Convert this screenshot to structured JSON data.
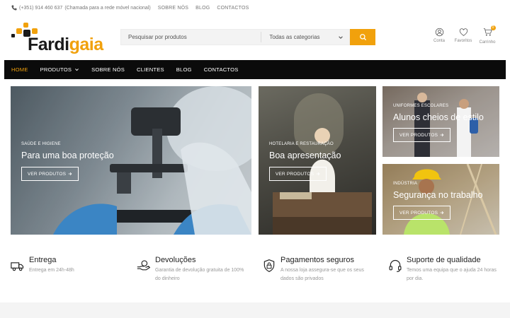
{
  "topbar": {
    "phone": "(+351) 914 460 637",
    "phone_note": "(Chamada para a rede móvel nacional)",
    "links": [
      "SOBRE NÓS",
      "BLOG",
      "CONTACTOS"
    ]
  },
  "logo": {
    "part1": "Fardi",
    "part2": "gaia"
  },
  "search": {
    "placeholder": "Pesquisar por produtos",
    "category": "Todas as categorias"
  },
  "header_icons": [
    {
      "name": "user-icon",
      "label": "Conta"
    },
    {
      "name": "heart-icon",
      "label": "Favoritos"
    },
    {
      "name": "cart-icon",
      "label": "Carrinho",
      "badge": "0"
    }
  ],
  "nav": {
    "items": [
      {
        "label": "HOME",
        "active": true
      },
      {
        "label": "PRODUTOS",
        "dropdown": true
      },
      {
        "label": "SOBRE NÓS"
      },
      {
        "label": "CLIENTES"
      },
      {
        "label": "BLOG"
      },
      {
        "label": "CONTACTOS"
      }
    ]
  },
  "banners": [
    {
      "label": "SAÚDE E HIGIENE",
      "headline": "Para uma boa proteção",
      "cta": "VER PRODUTOS"
    },
    {
      "label": "HOTELARIA E RESTAURAÇÃO",
      "headline": "Boa apresentação",
      "cta": "VER PRODUTOS"
    },
    {
      "label": "UNIFORMES ESCOLARES",
      "headline": "Alunos cheios de estilo",
      "cta": "VER PRODUTOS"
    },
    {
      "label": "INDÚSTRIA",
      "headline": "Segurança no trabalho",
      "cta": "VER PRODUTOS"
    }
  ],
  "features": [
    {
      "icon": "truck-icon",
      "title": "Entrega",
      "desc": "Entrega em 24h-48h"
    },
    {
      "icon": "hand-coin-icon",
      "title": "Devoluções",
      "desc": "Garantia de devolução gratuita de 100% do dinheiro"
    },
    {
      "icon": "shield-lock-icon",
      "title": "Pagamentos seguros",
      "desc": "A nossa loja assegura-se que os seus dados são privados"
    },
    {
      "icon": "headset-icon",
      "title": "Suporte de qualidade",
      "desc": "Temos uma equipa que o ajuda 24 horas por dia."
    }
  ],
  "colors": {
    "accent": "#f1a10c",
    "nav_bg": "#0b0b0b"
  }
}
